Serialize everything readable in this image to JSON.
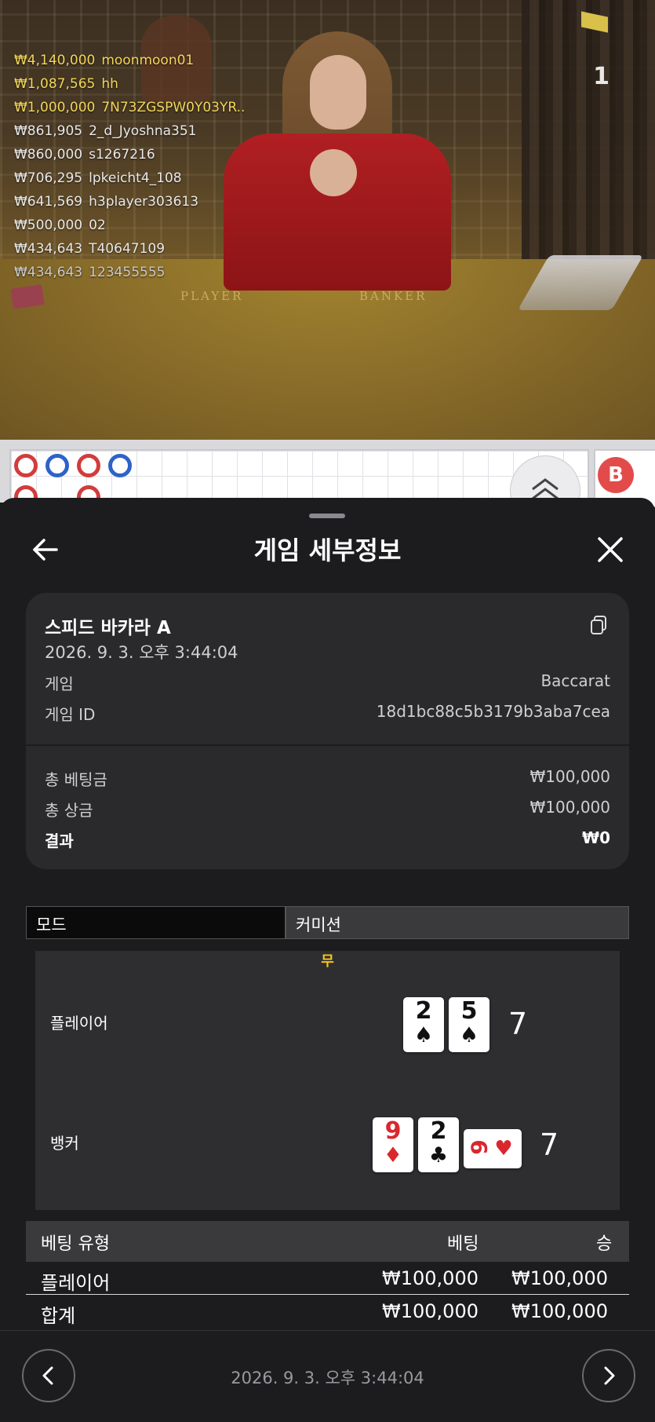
{
  "video": {
    "round_number": "1",
    "table_labels": {
      "player": "PLAYER",
      "banker": "BANKER"
    },
    "leaderboard": [
      {
        "amount": "₩4,140,000",
        "user": "moonmoon01"
      },
      {
        "amount": "₩1,087,565",
        "user": "hh"
      },
      {
        "amount": "₩1,000,000",
        "user": "7N73ZGSPW0Y03YR.."
      },
      {
        "amount": "₩861,905",
        "user": "2_d_Jyoshna351"
      },
      {
        "amount": "₩860,000",
        "user": "s1267216"
      },
      {
        "amount": "₩706,295",
        "user": "lpkeicht4_108"
      },
      {
        "amount": "₩641,569",
        "user": "h3player303613"
      },
      {
        "amount": "₩500,000",
        "user": "02"
      },
      {
        "amount": "₩434,643",
        "user": "T40647109"
      },
      {
        "amount": "₩434,643",
        "user": "123455555"
      }
    ],
    "leaderboard_colors": [
      "#f2d65a",
      "#f2d65a",
      "#f2d65a",
      "#e9e9e9",
      "#e9e9e9",
      "#e9e9e9",
      "#e9e9e9",
      "#e9e9e9",
      "#e9e9e9",
      "#c9c9c9"
    ]
  },
  "roadmap": {
    "badge": "B"
  },
  "sheet": {
    "title": "게임 세부정보",
    "back_icon": "arrow-left-icon",
    "close_icon": "close-icon",
    "game_name": "스피드 바카라 A",
    "game_time": "2026. 9. 3. 오후 3:44:04",
    "copy_icon": "copy-icon",
    "fields": [
      {
        "label": "게임",
        "value": "Baccarat"
      },
      {
        "label": "게임 ID",
        "value": "18d1bc88c5b3179b3aba7cea"
      }
    ],
    "totals": [
      {
        "label": "총 베팅금",
        "value": "₩100,000"
      },
      {
        "label": "총 상금",
        "value": "₩100,000"
      },
      {
        "label": "결과",
        "value": "₩0"
      }
    ],
    "mode_label": "모드",
    "commission_label": "커미션",
    "result_tag": "무",
    "player": {
      "label": "플레이어",
      "cards": [
        {
          "rank": "2",
          "suit": "♠"
        },
        {
          "rank": "5",
          "suit": "♠"
        }
      ],
      "score": "7"
    },
    "banker": {
      "label": "뱅커",
      "cards": [
        {
          "rank": "9",
          "suit": "♦"
        },
        {
          "rank": "2",
          "suit": "♣"
        },
        {
          "rank": "6",
          "suit": "♥"
        }
      ],
      "score": "7"
    },
    "bets": {
      "headers": {
        "type": "베팅 유형",
        "bet": "베팅",
        "win": "승"
      },
      "rows": [
        {
          "type": "플레이어",
          "bet": "₩100,000",
          "win": "₩100,000"
        }
      ],
      "total": {
        "type": "합계",
        "bet": "₩100,000",
        "win": "₩100,000"
      }
    },
    "footer": {
      "prev_icon": "chevron-left-icon",
      "next_icon": "chevron-right-icon",
      "time": "2026. 9. 3. 오후 3:44:04"
    }
  }
}
